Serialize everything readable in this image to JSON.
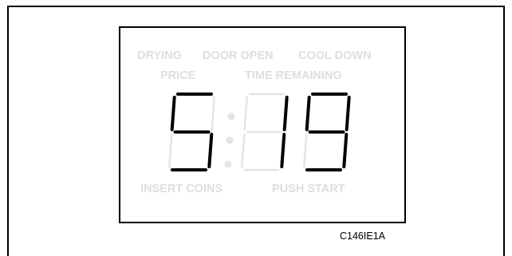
{
  "display": {
    "indicators": {
      "drying": "DRYING",
      "door_open": "DOOR OPEN",
      "cool_down": "COOL DOWN",
      "price": "PRICE",
      "time_remaining": "TIME REMAINING",
      "insert_coins": "INSERT COINS",
      "push_start": "PUSH START"
    },
    "readout": {
      "value": "5:19",
      "digits": [
        "",
        "5",
        "1",
        "9"
      ]
    },
    "colors": {
      "lit_segment": "#000000",
      "unlit_segment": "#e4e4e4",
      "unlit_text": "#dedede"
    }
  },
  "figure": {
    "reference_code": "C146IE1A"
  }
}
